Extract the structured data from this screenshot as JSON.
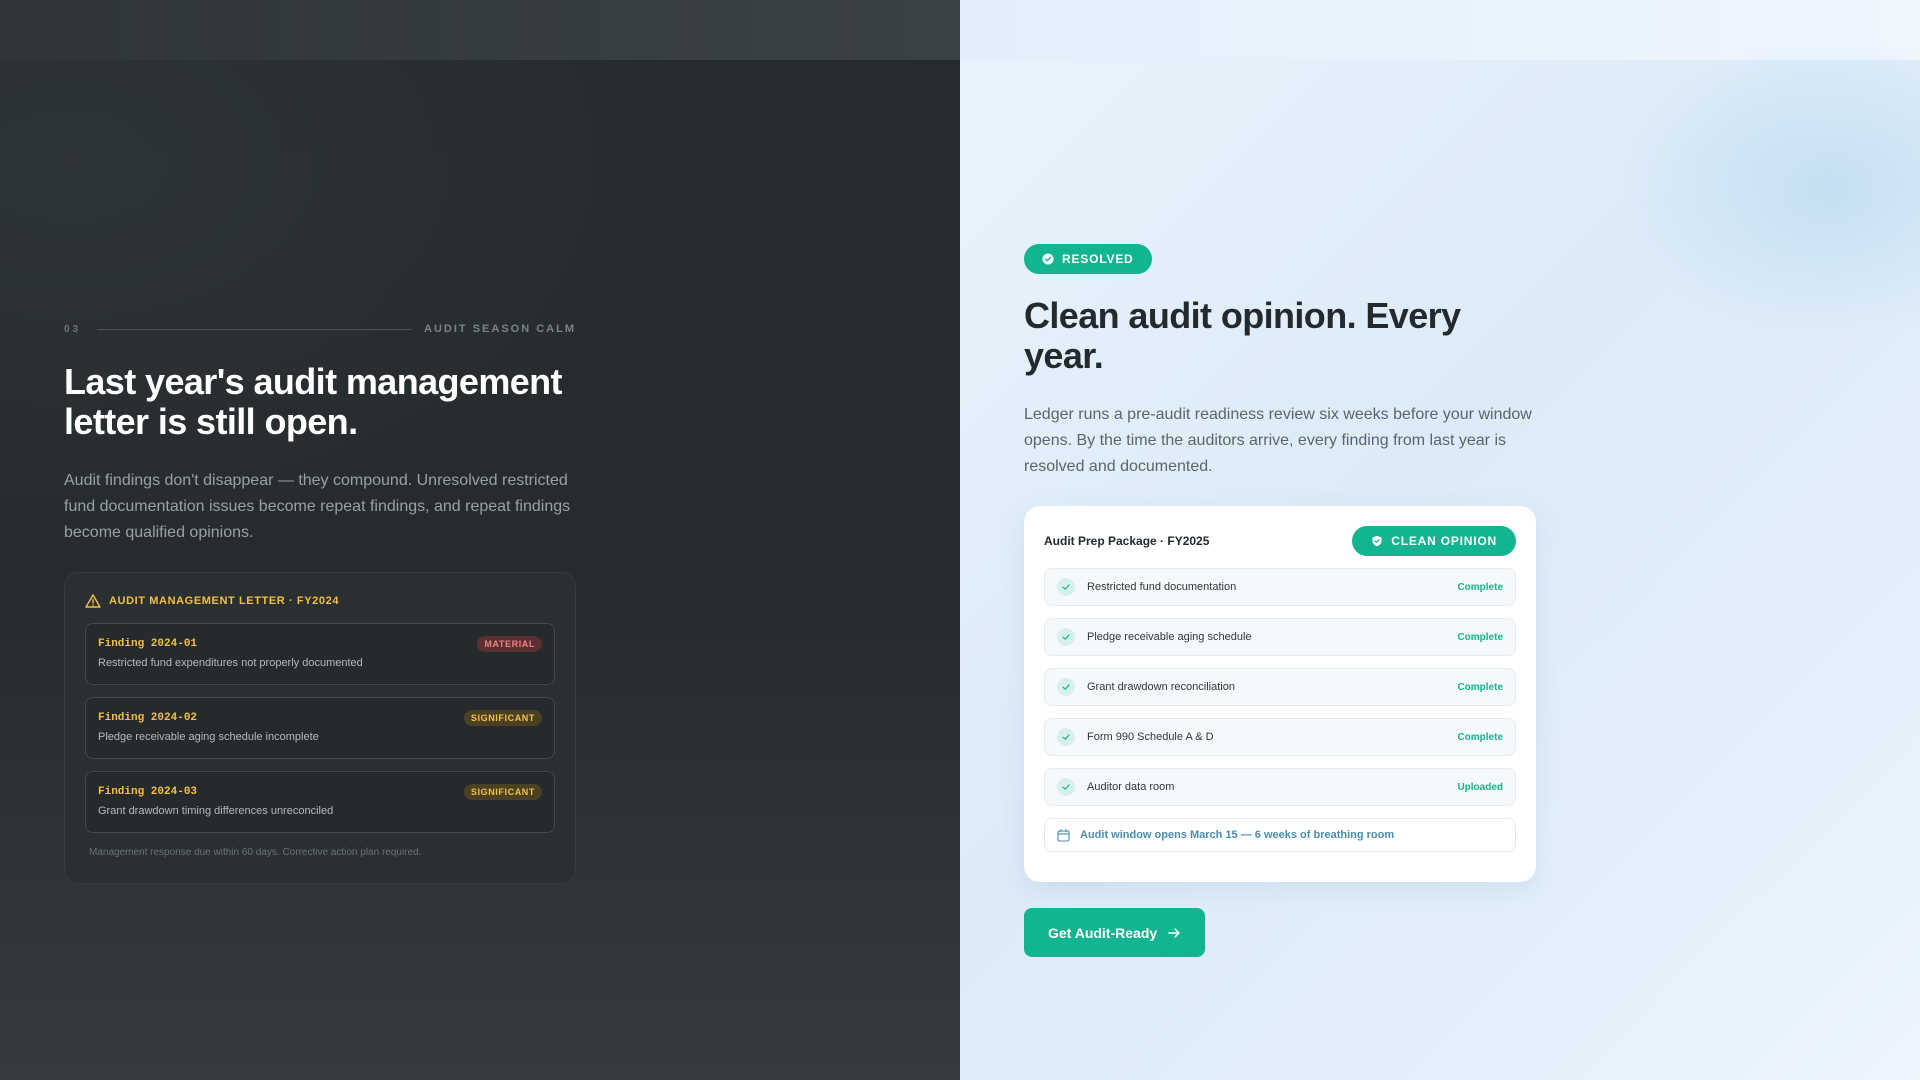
{
  "left": {
    "eyebrow_number": "03",
    "eyebrow_tag": "AUDIT SEASON CALM",
    "title": "Last year's audit management letter is still open.",
    "description": "Audit findings don't disappear — they compound. Unresolved restricted fund documentation issues become repeat findings, and repeat findings become qualified opinions.",
    "letter": {
      "title": "AUDIT MANAGEMENT LETTER · FY2024",
      "icon": "warning-icon",
      "findings": [
        {
          "id": "Finding 2024-01",
          "text": "Restricted fund expenditures not properly documented",
          "badge": "MATERIAL"
        },
        {
          "id": "Finding 2024-02",
          "text": "Pledge receivable aging schedule incomplete",
          "badge": "SIGNIFICANT"
        },
        {
          "id": "Finding 2024-03",
          "text": "Grant drawdown timing differences unreconciled",
          "badge": "SIGNIFICANT"
        }
      ],
      "footnote": "Management response due within 60 days. Corrective action plan required."
    }
  },
  "right": {
    "badge": "RESOLVED",
    "title": "Clean audit opinion. Every year.",
    "description": "Ledger runs a pre-audit readiness review six weeks before your window opens. By the time the auditors arrive, every finding from last year is resolved and documented.",
    "package": {
      "title": "Audit Prep Package · FY2025",
      "badge": "CLEAN OPINION",
      "items": [
        {
          "label": "Restricted fund documentation",
          "status": "Complete"
        },
        {
          "label": "Pledge receivable aging schedule",
          "status": "Complete"
        },
        {
          "label": "Grant drawdown reconciliation",
          "status": "Complete"
        },
        {
          "label": "Form 990 Schedule A & D",
          "status": "Complete"
        },
        {
          "label": "Auditor data room",
          "status": "Uploaded"
        }
      ],
      "window_note": "Audit window opens March 15 — 6 weeks of breathing room"
    },
    "cta": "Get Audit-Ready"
  },
  "colors": {
    "accent": "#12b58f",
    "warning": "#f2c043",
    "material": "#f07f7f",
    "dark_bg": "#262b2d",
    "light_bg": "#e9f3fc"
  }
}
